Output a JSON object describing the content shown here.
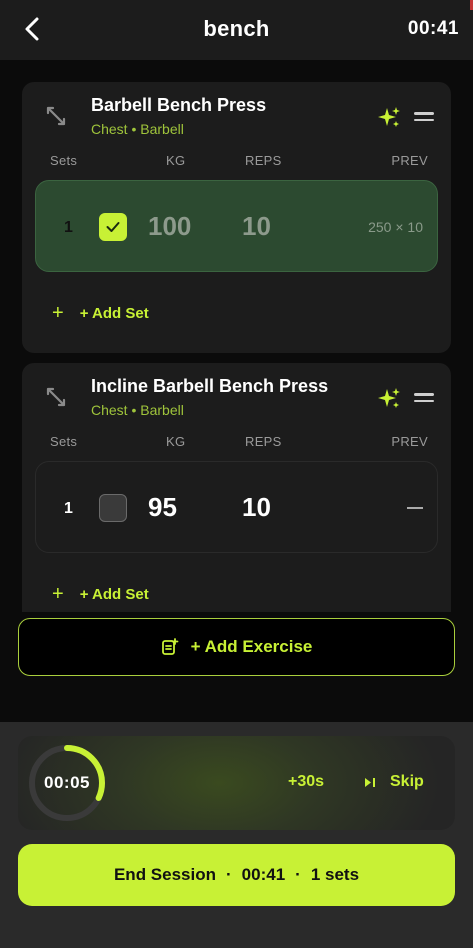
{
  "header": {
    "title": "bench",
    "timer": "00:41"
  },
  "columns": {
    "sets": "Sets",
    "kg": "KG",
    "reps": "REPS",
    "prev": "PREV"
  },
  "exercises": [
    {
      "name": "Barbell Bench Press",
      "subtitle": "Chest • Barbell",
      "sets": [
        {
          "num": "1",
          "done": true,
          "kg": "100",
          "reps": "10",
          "prev": "250 × 10"
        }
      ],
      "add_set_label": "+ Add Set"
    },
    {
      "name": "Incline Barbell Bench Press",
      "subtitle": "Chest • Barbell",
      "sets": [
        {
          "num": "1",
          "done": false,
          "kg": "95",
          "reps": "10",
          "prev": ""
        }
      ],
      "add_set_label": "+ Add Set"
    }
  ],
  "add_exercise_label": "+ Add Exercise",
  "rest": {
    "time": "00:05",
    "progress": 0.32,
    "add30_label": "+30s",
    "skip_label": "Skip"
  },
  "end_session": {
    "label": "End Session",
    "time": "00:41",
    "sets": "1 sets"
  },
  "colors": {
    "accent": "#c8f135",
    "done_row": "#2c4a30",
    "subtitle": "#9fc43b"
  },
  "icons": [
    "back-chevron-icon",
    "dumbbell-icon",
    "sparkle-icon",
    "drag-handle-icon",
    "check-icon",
    "plus-icon",
    "add-note-icon",
    "skip-icon"
  ]
}
